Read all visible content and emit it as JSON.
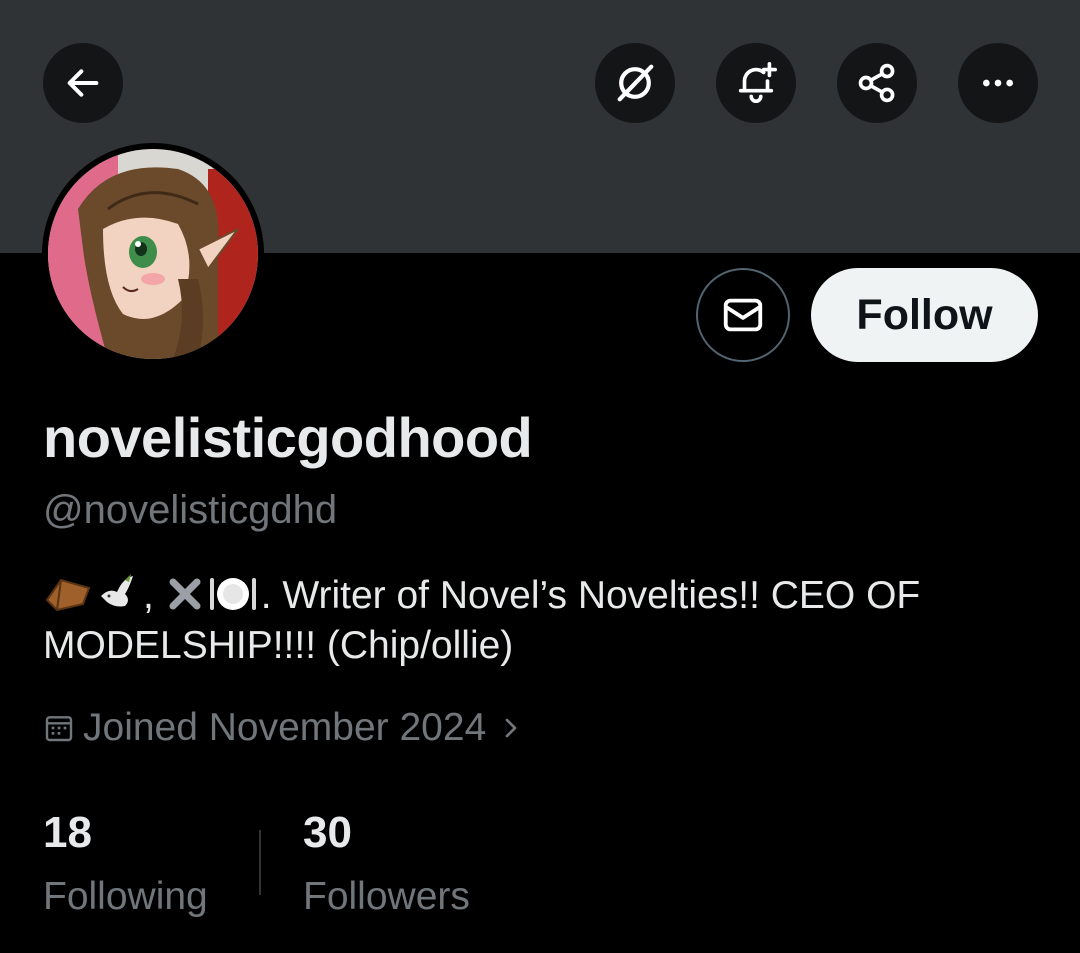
{
  "header": {
    "back_icon": "arrow-left-icon",
    "grok_icon": "grok-icon",
    "notify_icon": "bell-plus-icon",
    "share_icon": "share-icon",
    "more_icon": "more-horizontal-icon"
  },
  "profile": {
    "display_name": "novelisticgodhood",
    "handle": "@novelisticgdhd",
    "bio_emojis": [
      "coffin",
      "dove",
      "cross-mark",
      "plate-with-cutlery"
    ],
    "bio_comma": ",",
    "bio_text": ". Writer of Novel’s Novelties!!  CEO OF MODELSHIP!!!! (Chip/ollie)",
    "joined_text": "Joined November 2024"
  },
  "actions": {
    "message_icon": "mail-icon",
    "follow_label": "Follow"
  },
  "stats": {
    "following_count": "18",
    "following_label": "Following",
    "followers_count": "30",
    "followers_label": "Followers"
  },
  "colors": {
    "background": "#000000",
    "banner": "#2f3336",
    "primary_text": "#e7e9ea",
    "secondary_text": "#71767b",
    "follow_bg": "#eff3f4"
  }
}
